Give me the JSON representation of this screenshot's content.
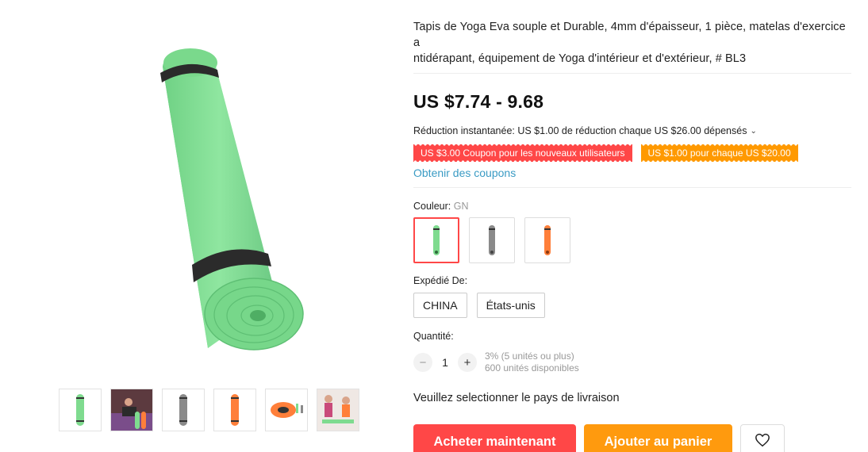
{
  "product": {
    "title": "Tapis de Yoga Eva souple et Durable, 4mm d'épaisseur, 1 pièce, matelas d'exercice antidérapant, équipement de Yoga d'intérieur et d'extérieur, # BL3",
    "title_line1": "Tapis de Yoga Eva souple et Durable, 4mm d'épaisseur, 1 pièce, matelas d'exercice a",
    "title_line2": "ntidérapant, équipement de Yoga d'intérieur et d'extérieur, # BL3",
    "price": "US $7.74 - 9.68"
  },
  "promo": {
    "instant_discount": "Réduction instantanée: US $1.00 de réduction chaque US $26.00 dépensés",
    "coupons": [
      {
        "label": "US $3.00 Coupon pour les nouveaux utilisateurs",
        "color": "#ff4747"
      },
      {
        "label": "US $1.00 pour chaque US $20.00",
        "color": "#ff9900"
      }
    ],
    "get_coupons": "Obtenir des coupons"
  },
  "color": {
    "label": "Couleur:",
    "selected": "GN",
    "options": [
      {
        "name": "green",
        "hex": "#7fdb8f"
      },
      {
        "name": "gray",
        "hex": "#8a8a8a"
      },
      {
        "name": "orange",
        "hex": "#ff7f3a"
      }
    ]
  },
  "shipping": {
    "label": "Expédié De:",
    "options": [
      "CHINA",
      "États-unis"
    ]
  },
  "quantity": {
    "label": "Quantité:",
    "value": "1",
    "decrement": "−",
    "increment": "+",
    "discount_note": "3% (5 unités ou plus)",
    "available": "600 unités disponibles"
  },
  "delivery_note": "Veuillez selectionner le pays de livraison",
  "actions": {
    "buy_now": "Acheter maintenant",
    "add_to_cart": "Ajouter au panier"
  },
  "icons": {
    "wishlist": "heart-icon",
    "dropdown": "chevron-down-icon"
  }
}
